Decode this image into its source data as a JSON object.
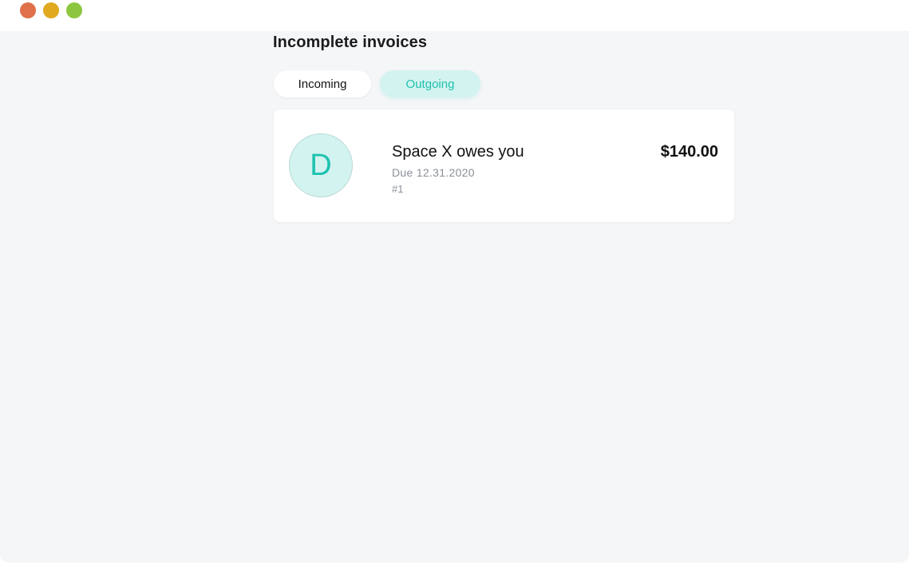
{
  "window": {
    "controls": {
      "close_color": "#e0704a",
      "minimize_color": "#e0a91f",
      "maximize_color": "#8cc63e"
    }
  },
  "page": {
    "title": "Incomplete invoices"
  },
  "tabs": [
    {
      "label": "Incoming",
      "active": false
    },
    {
      "label": "Outgoing",
      "active": true
    }
  ],
  "accent_color": "#1fc2b0",
  "invoices": [
    {
      "avatar_letter": "D",
      "title": "Space X owes you",
      "due": "Due 12.31.2020",
      "number": "#1",
      "amount": "$140.00"
    }
  ]
}
